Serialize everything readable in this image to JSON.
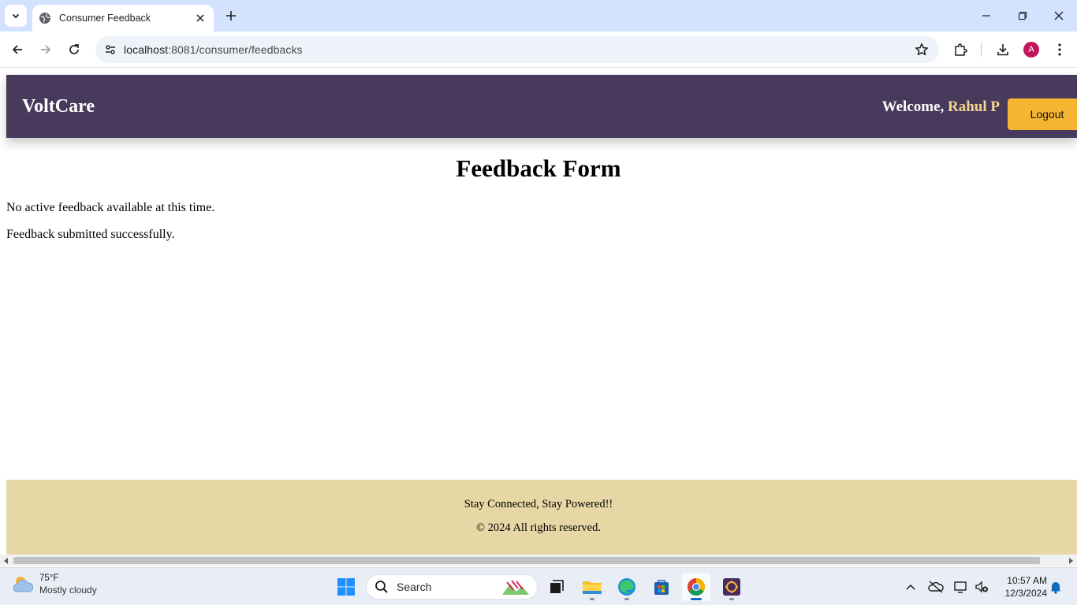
{
  "browser": {
    "tab_title": "Consumer Feedback",
    "url_host": "localhost",
    "url_path": ":8081/consumer/feedbacks",
    "profile_initial": "A"
  },
  "header": {
    "brand": "VoltCare",
    "welcome_prefix": "Welcome, ",
    "username": "Rahul P",
    "logout_label": "Logout",
    "background_color": "#483a5c",
    "accent_color": "#f5b531"
  },
  "main": {
    "title": "Feedback Form",
    "messages": [
      "No active feedback available at this time.",
      "Feedback submitted successfully."
    ]
  },
  "footer": {
    "tagline": "Stay Connected, Stay Powered!!",
    "copyright": "© 2024 All rights reserved.",
    "background_color": "#e6d8a4"
  },
  "taskbar": {
    "weather_temp": "75°F",
    "weather_desc": "Mostly cloudy",
    "search_label": "Search",
    "time": "10:57 AM",
    "date": "12/3/2024",
    "apps": [
      "start-icon",
      "search-icon",
      "task-view-icon",
      "file-explorer-icon",
      "edge-icon",
      "store-icon",
      "chrome-icon",
      "app-icon"
    ]
  }
}
